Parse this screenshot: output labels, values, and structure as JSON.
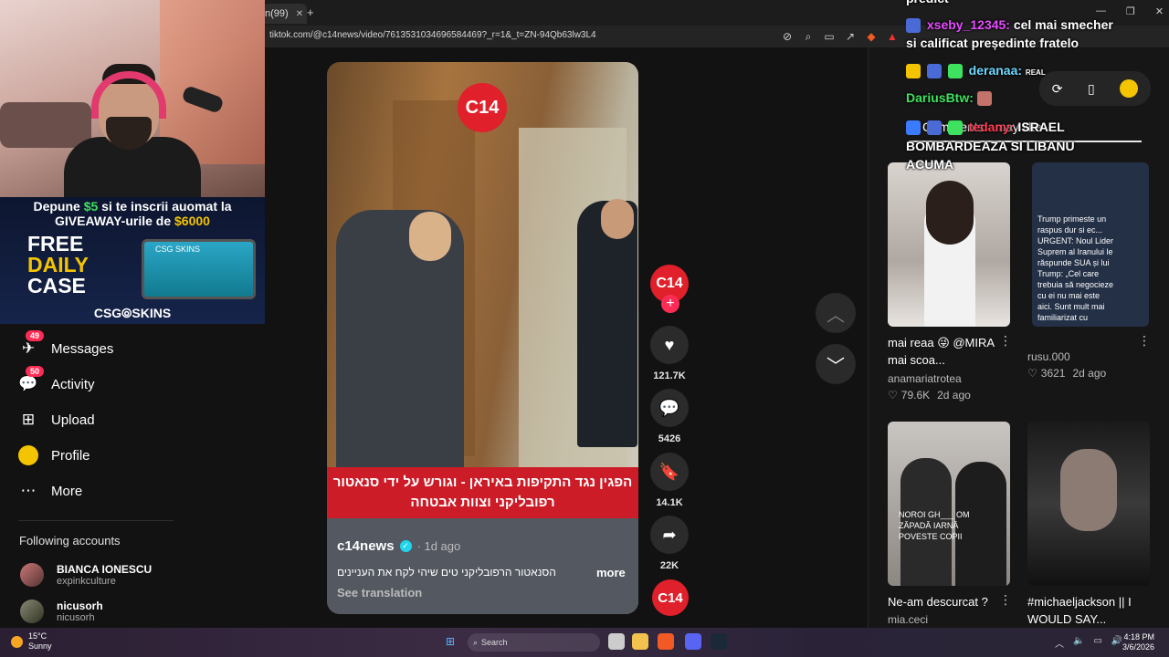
{
  "browser": {
    "tab_title": "n(99)",
    "tab_close": "✕",
    "new_tab": "+",
    "url": "tiktok.com/@c14news/video/7613531034696584469?_r=1&_t=ZN-94Qb63lw3L4"
  },
  "overlay_ad": {
    "line1_pre": "Depune",
    "line1_amount": "$5",
    "line1_post": "si te inscrii auomat la",
    "line2_pre": "GIVEAWAY-urile de",
    "line2_amount": "$6000",
    "free": "FREE",
    "daily": "DAILY",
    "case": "CASE",
    "case_label": "CSG SKINS",
    "brand": "CSG⦾SKINS"
  },
  "sidebar": {
    "items": [
      {
        "label": "Messages",
        "badge": "49",
        "icon": "✈"
      },
      {
        "label": "Activity",
        "badge": "50",
        "icon": "💬"
      },
      {
        "label": "Upload",
        "badge": "",
        "icon": "⊞"
      },
      {
        "label": "Profile",
        "badge": "",
        "icon": "●"
      },
      {
        "label": "More",
        "badge": "",
        "icon": "⋯"
      }
    ],
    "following_header": "Following accounts",
    "accounts": [
      {
        "name": "BIANCA IONESCU",
        "handle": "expinkculture"
      },
      {
        "name": "nicusorh",
        "handle": "nicusorh"
      }
    ]
  },
  "video": {
    "logo": "C14",
    "caption": "הפגין נגד התקיפות באיראן - וגורש על ידי סנאטור רפובליקני וצוות אבטחה",
    "author": "c14news",
    "time": "· 1d ago",
    "description": "הסנאטור הרפובליקני טים שיהי לקח את העניינים",
    "more": "more",
    "see_translation": "See translation"
  },
  "actions": {
    "avatar": "C14",
    "likes": "121.7K",
    "comments": "5426",
    "saves": "14.1K",
    "shares": "22K",
    "music": "C14"
  },
  "chat": {
    "top_line": "predict",
    "messages": [
      {
        "user": "xseby_12345:",
        "text": "cel mai smecher"
      },
      {
        "user": "",
        "text": "si calificat președinte fratelo"
      },
      {
        "user": "deranaa:",
        "text": "REAL"
      },
      {
        "user": "DariusBtw:",
        "text": ""
      },
      {
        "user": "tedany:",
        "text": "ISRAEL"
      },
      {
        "user": "",
        "text": "BOMBARDEAZA SI LIBANU"
      },
      {
        "user": "",
        "text": "ACUMA"
      }
    ],
    "under_text": "Comments   may like"
  },
  "recommended": [
    {
      "title": "mai reaa 😜 @MIRA mai scoa...",
      "user": "anamariatrotea",
      "likes": "79.6K",
      "age": "2d ago",
      "thumb_text": ""
    },
    {
      "title": "",
      "user": "rusu.000",
      "likes": "3621",
      "age": "2d ago",
      "thumb_text": "Trump primeste un raspus dur si ec... URGENT: Noul Lider Suprem al Iranului le răspunde SUA și lui Trump: „Cel care trebuia să negocieze cu ei nu mai este aici. Sunt mult mai familiarizat cu limbajul armelor decât cu cel al diplomației. Nu vom"
    },
    {
      "title": "Ne-am descurcat ?",
      "user": "mia.ceci",
      "likes": "",
      "age": "",
      "thumb_text": "NOROI GH___  OM ZĂPADĂ IARNĂ POVESTE COPII"
    },
    {
      "title": "#michaeljackson || I WOULD SAY...",
      "user": "",
      "likes": "",
      "age": "",
      "thumb_text": ""
    }
  ],
  "taskbar": {
    "temp": "15°C",
    "weather": "Sunny",
    "search": "Search",
    "time": "4:18 PM",
    "date": "3/6/2026"
  },
  "colors": {
    "accent": "#fe2c55",
    "c14_red": "#e0202a",
    "background": "#121212"
  }
}
